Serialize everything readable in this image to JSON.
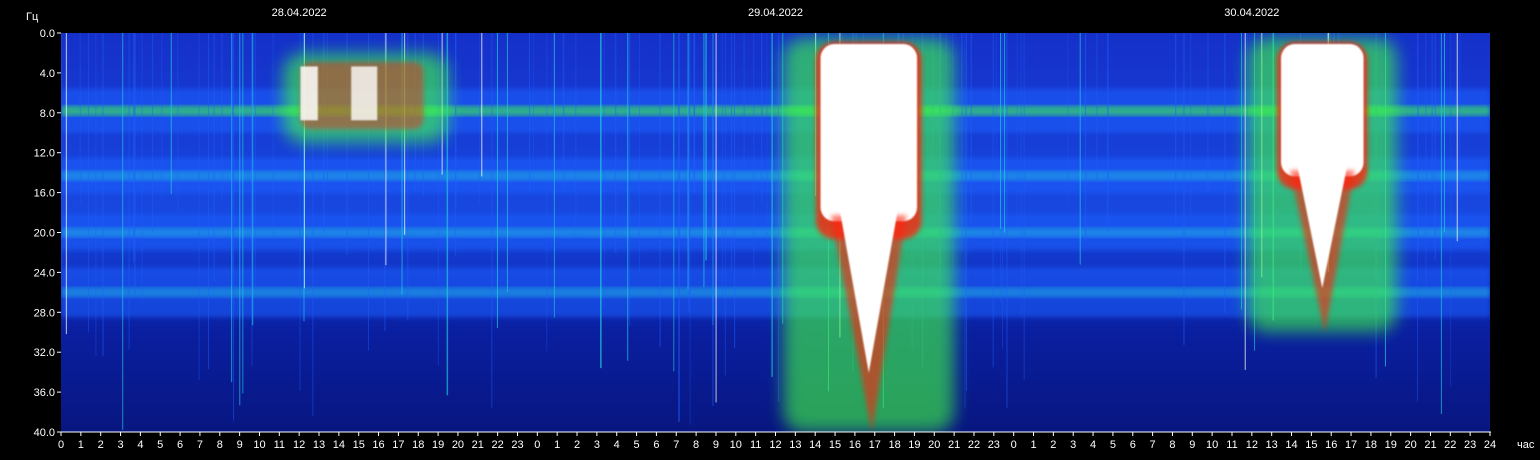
{
  "chart_data": {
    "type": "heatmap",
    "title": "",
    "ylabel": "Гц",
    "xlabel": "час",
    "ylim": [
      0,
      40
    ],
    "y_ticks": [
      "0.0",
      "4.0",
      "8.0",
      "12.0",
      "16.0",
      "20.0",
      "24.0",
      "28.0",
      "32.0",
      "36.0",
      "40.0"
    ],
    "x_range_hours": [
      0,
      72
    ],
    "x_tick_labels": [
      "0",
      "1",
      "2",
      "3",
      "4",
      "5",
      "6",
      "7",
      "8",
      "9",
      "10",
      "11",
      "12",
      "13",
      "14",
      "15",
      "16",
      "17",
      "18",
      "19",
      "20",
      "21",
      "22",
      "23",
      "0",
      "1",
      "2",
      "3",
      "4",
      "5",
      "6",
      "7",
      "8",
      "9",
      "10",
      "11",
      "12",
      "13",
      "14",
      "15",
      "16",
      "17",
      "18",
      "19",
      "20",
      "21",
      "22",
      "23",
      "0",
      "1",
      "2",
      "3",
      "4",
      "5",
      "6",
      "7",
      "8",
      "9",
      "10",
      "11",
      "12",
      "13",
      "14",
      "15",
      "16",
      "17",
      "18",
      "19",
      "20",
      "21",
      "22",
      "23",
      "24"
    ],
    "dates": [
      {
        "label": "28.04.2022",
        "hour": 12
      },
      {
        "label": "29.04.2022",
        "hour": 36
      },
      {
        "label": "30.04.2022",
        "hour": 60
      }
    ],
    "resonance_bands_hz": [
      7.8,
      14.3,
      20.0,
      26.0
    ],
    "bursts": [
      {
        "start_hour": 11.7,
        "end_hour": 19,
        "top_hz": 2,
        "bottom_hz": 11,
        "intensity": "high"
      },
      {
        "start_hour": 36.9,
        "end_hour": 44.5,
        "top_hz": 0.5,
        "bottom_hz": 40,
        "intensity": "saturated"
      },
      {
        "start_hour": 60.3,
        "end_hour": 66.8,
        "top_hz": 0.5,
        "bottom_hz": 30,
        "intensity": "saturated"
      }
    ],
    "colors": {
      "background": "#000000",
      "low": "#0a1a9a",
      "mid": "#1e60ff",
      "cyan": "#20d0e0",
      "green": "#40ff40",
      "red": "#ff2010",
      "saturated": "#ffffff"
    }
  }
}
